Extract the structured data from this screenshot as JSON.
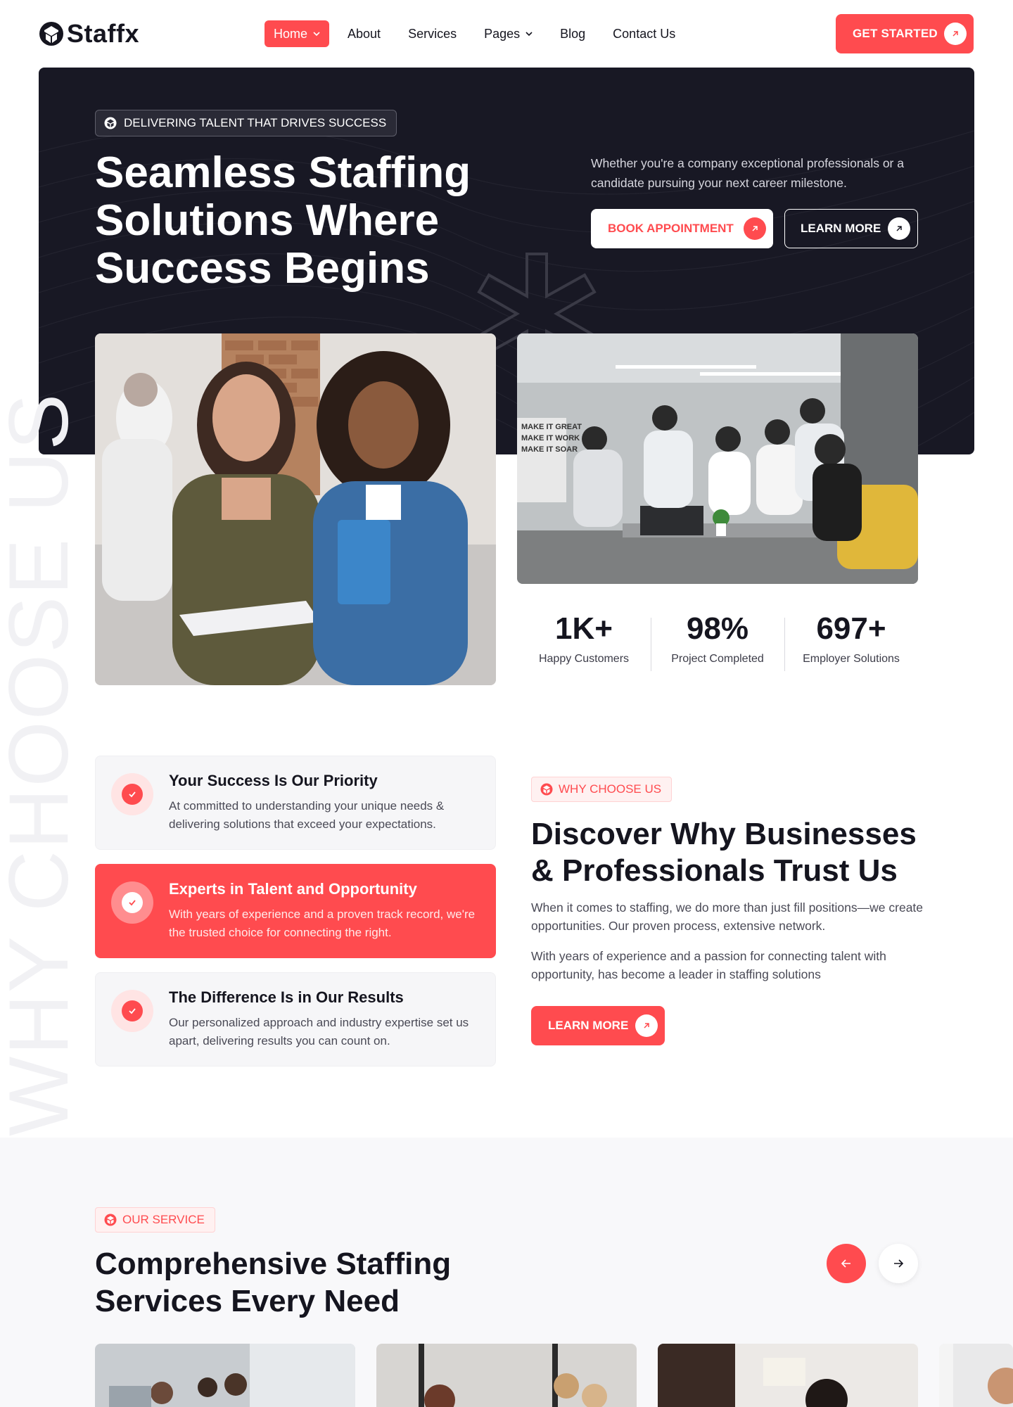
{
  "brand": {
    "name": "Staffx",
    "accent": "#ff4b4f",
    "dark": "#181824"
  },
  "nav": {
    "items": [
      {
        "label": "Home",
        "active": true,
        "has_dropdown": true
      },
      {
        "label": "About",
        "active": false,
        "has_dropdown": false
      },
      {
        "label": "Services",
        "active": false,
        "has_dropdown": false
      },
      {
        "label": "Pages",
        "active": false,
        "has_dropdown": true
      },
      {
        "label": "Blog",
        "active": false,
        "has_dropdown": false
      },
      {
        "label": "Contact Us",
        "active": false,
        "has_dropdown": false
      }
    ],
    "cta_label": "GET STARTED"
  },
  "hero": {
    "badge": "DELIVERING TALENT THAT DRIVES SUCCESS",
    "title": "Seamless Staffing Solutions Where Success Begins",
    "description": "Whether you're a company exceptional professionals or a candidate pursuing your next career milestone.",
    "primary_button": "BOOK APPOINTMENT",
    "secondary_button": "LEARN MORE"
  },
  "photos": {
    "left_icon": "two-women-photo",
    "right_icon": "team-meeting-photo"
  },
  "stats": [
    {
      "value": "1K+",
      "label": "Happy Customers"
    },
    {
      "value": "98%",
      "label": "Project Completed"
    },
    {
      "value": "697+",
      "label": "Employer Solutions"
    }
  ],
  "why": {
    "watermark": "WHY CHOOSE US",
    "tag": "WHY CHOOSE US",
    "title": "Discover Why Businesses & Professionals Trust Us",
    "paragraph_1": "When it comes to staffing, we do more than just fill positions—we create opportunities. Our proven process, extensive network.",
    "paragraph_2": "With years of experience and a passion for connecting talent with opportunity, has become a leader in staffing solutions",
    "button": "LEARN MORE",
    "cards": [
      {
        "title": "Your Success Is Our Priority",
        "text": "At committed to understanding your unique needs & delivering solutions that exceed your expectations.",
        "highlighted": false
      },
      {
        "title": "Experts in Talent and Opportunity",
        "text": "With years of experience and a proven track record, we're the trusted choice for connecting the right.",
        "highlighted": true
      },
      {
        "title": "The Difference Is in Our Results",
        "text": "Our personalized approach and industry expertise set us apart, delivering results you can count on.",
        "highlighted": false
      }
    ]
  },
  "services": {
    "tag": "OUR SERVICE",
    "title": "Comprehensive Staffing Services Every Need",
    "prev_icon": "arrow-left-icon",
    "next_icon": "arrow-right-icon"
  }
}
